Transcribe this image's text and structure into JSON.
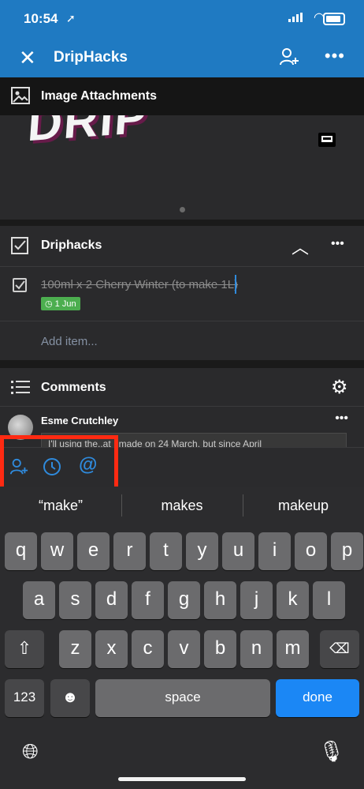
{
  "status_bar": {
    "time": "10:54",
    "location_icon": "location-arrow-icon"
  },
  "header": {
    "title": "DripHacks",
    "close_icon": "close-icon",
    "add_member_icon": "add-member-icon",
    "more_icon": "more-icon"
  },
  "attachments": {
    "title": "Image Attachments"
  },
  "checklist": {
    "title": "Driphacks",
    "item_text": "100ml x 2 Cherry Winter (to make 1L)",
    "due_badge": "1 Jun",
    "add_item": "Add item..."
  },
  "comments": {
    "title": "Comments",
    "author": "Esme Crutchley",
    "preview": "I'll using the..at I made on 24 March, but since April"
  },
  "accessory": {
    "icons": [
      "add-member-icon",
      "clock-icon",
      "mention-icon"
    ]
  },
  "keyboard": {
    "suggestions": [
      "“make”",
      "makes",
      "makeup"
    ],
    "row1": [
      "q",
      "w",
      "e",
      "r",
      "t",
      "y",
      "u",
      "i",
      "o",
      "p"
    ],
    "row2": [
      "a",
      "s",
      "d",
      "f",
      "g",
      "h",
      "j",
      "k",
      "l"
    ],
    "row3": [
      "z",
      "x",
      "c",
      "v",
      "b",
      "n",
      "m"
    ],
    "num_label": "123",
    "space_label": "space",
    "done_label": "done"
  },
  "colors": {
    "header_blue": "#1f7ac2",
    "accent_blue": "#2f8bdd",
    "highlight_red": "#ff2a12",
    "done_blue": "#1b87f5",
    "badge_green": "#4cae4f"
  }
}
